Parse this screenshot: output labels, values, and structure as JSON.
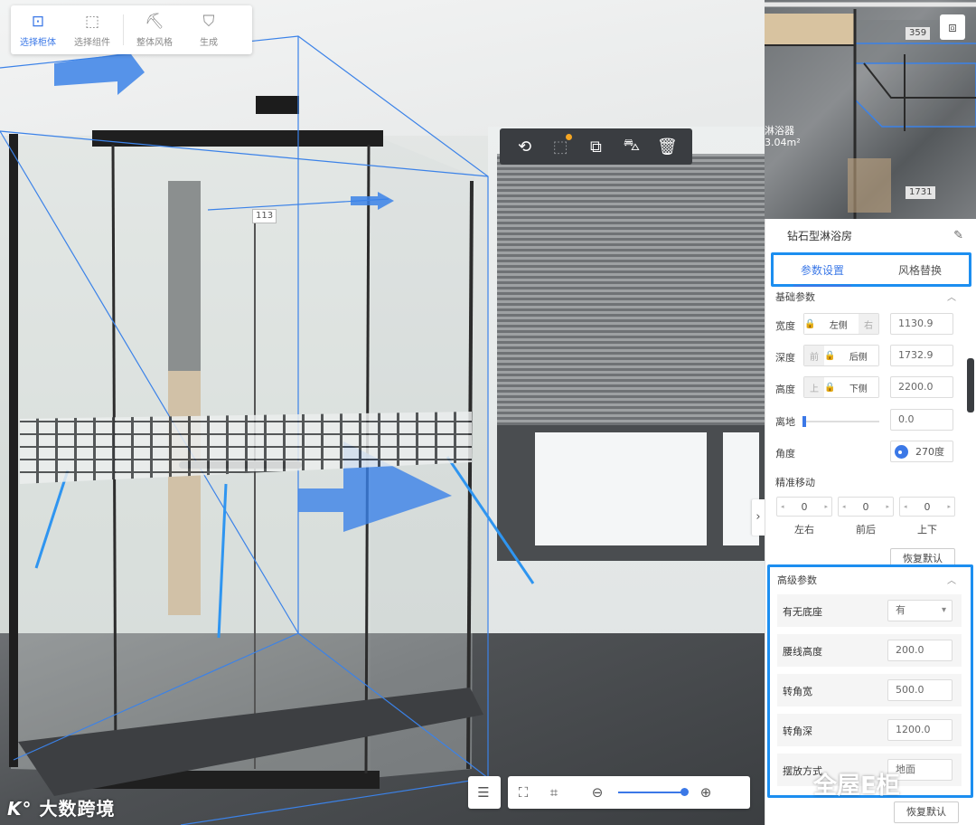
{
  "toolbar": {
    "items": [
      {
        "label": "选择柜体",
        "icon": "select-cabinet-icon",
        "active": true
      },
      {
        "label": "选择组件",
        "icon": "select-component-icon",
        "active": false
      },
      {
        "label": "整体风格",
        "icon": "overall-style-icon",
        "active": false
      },
      {
        "label": "生成",
        "icon": "generate-icon",
        "active": false
      }
    ]
  },
  "object_toolbar": {
    "icons": [
      "rotate-icon",
      "group-icon",
      "copy-icon",
      "style-brush-icon",
      "delete-icon"
    ]
  },
  "viewport": {
    "dimension_label": "113"
  },
  "minimap": {
    "label_top": "359",
    "label_bottom": "1731",
    "area_text_line1": "淋浴器",
    "area_text_line2": "3.04m²",
    "icon": "view-switch-icon"
  },
  "panel": {
    "title": "钻石型淋浴房",
    "edit_icon": "edit-icon",
    "tabs": [
      "参数设置",
      "风格替换"
    ],
    "active_tab": 0,
    "basic": {
      "title": "基础参数",
      "width": {
        "label": "宽度",
        "left": "左侧",
        "right": "右",
        "value": "1130.9"
      },
      "depth": {
        "label": "深度",
        "front": "前",
        "back": "后侧",
        "value": "1732.9"
      },
      "height": {
        "label": "高度",
        "top": "上",
        "bottom": "下侧",
        "value": "2200.0"
      },
      "offset": {
        "label": "离地",
        "value": "0.0",
        "slider_fraction": 0.0
      },
      "angle": {
        "label": "角度",
        "value": "270度"
      },
      "precise_move": {
        "label": "精准移动",
        "steppers": [
          {
            "value": "0",
            "label": "左右"
          },
          {
            "value": "0",
            "label": "前后"
          },
          {
            "value": "0",
            "label": "上下"
          }
        ]
      },
      "reset_label": "恢复默认"
    },
    "advanced": {
      "title": "高级参数",
      "rows": [
        {
          "label": "有无底座",
          "value": "有",
          "type": "select"
        },
        {
          "label": "腰线高度",
          "value": "200.0",
          "type": "input"
        },
        {
          "label": "转角宽",
          "value": "500.0",
          "type": "input"
        },
        {
          "label": "转角深",
          "value": "1200.0",
          "type": "input"
        },
        {
          "label": "摆放方式",
          "value": "地面",
          "type": "input"
        }
      ],
      "reset_label": "恢复默认"
    }
  },
  "watermarks": {
    "left": "大数跨境",
    "right": "全屋E柜"
  },
  "colors": {
    "accent": "#3b78e7",
    "highlight_border": "#1c8ef0",
    "toolbar_dark": "#3a3d41"
  }
}
